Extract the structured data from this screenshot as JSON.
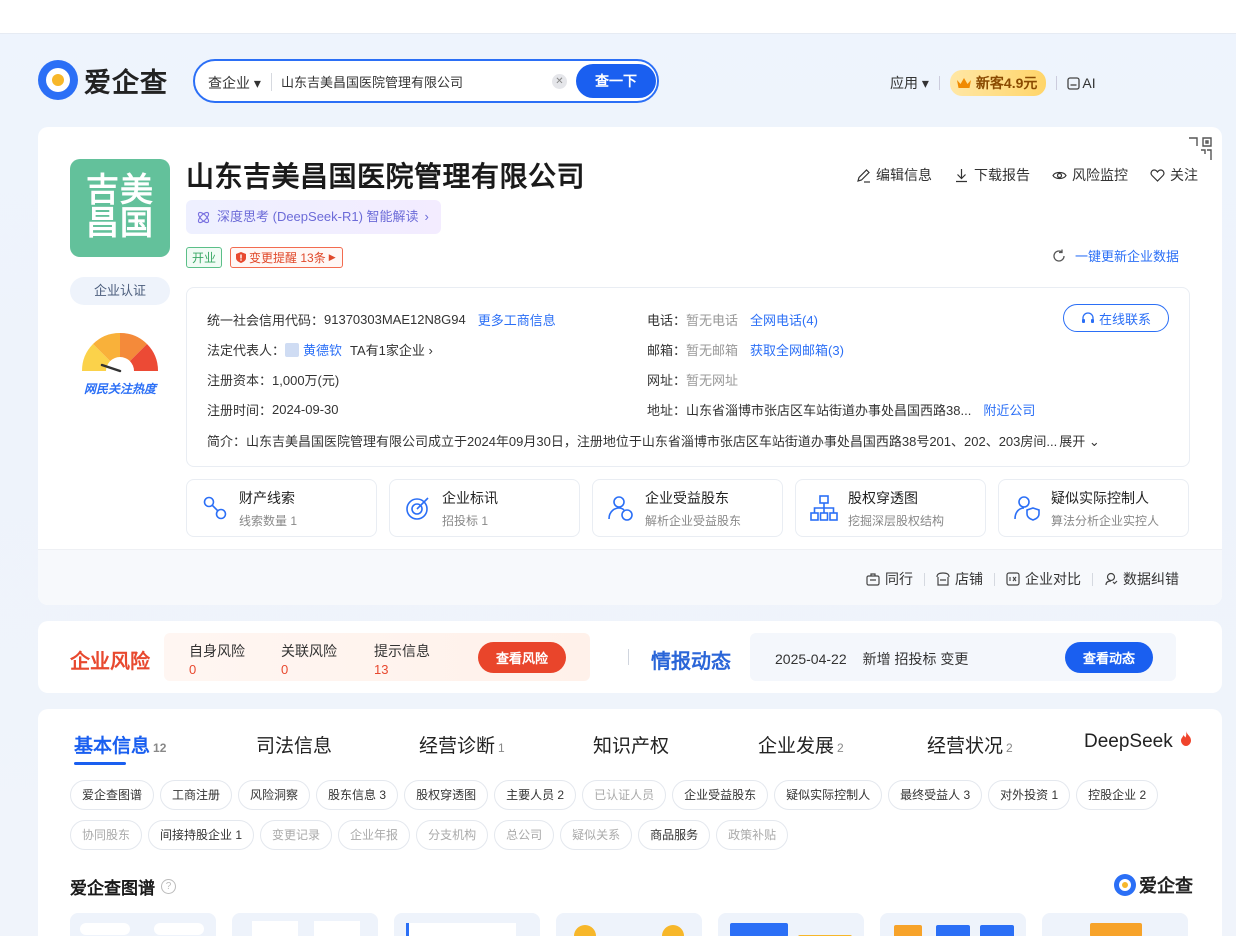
{
  "header": {
    "logo_text": "爱企查",
    "search_type": "查企业",
    "search_value": "山东吉美昌国医院管理有限公司",
    "search_button": "查一下",
    "apps_label": "应用",
    "vip_label": "新客4.9元",
    "ai_label": "AI"
  },
  "company": {
    "avatar_text": "吉美昌国",
    "name": "山东吉美昌国医院管理有限公司",
    "deepseek_tag": "深度思考 (DeepSeek-R1) 智能解读",
    "status": "开业",
    "change_alert": "变更提醒 13条",
    "certify": "企业认证",
    "heat_label": "网民关注热度",
    "actions": [
      "编辑信息",
      "下载报告",
      "风险监控",
      "关注"
    ],
    "refresh": "一键更新企业数据"
  },
  "info": {
    "credit_label": "统一社会信用代码：",
    "credit_value": "91370303MAE12N8G94",
    "more_biz": "更多工商信息",
    "legal_label": "法定代表人：",
    "legal_name": "黄德钦",
    "legal_extra": "TA有1家企业",
    "capital_label": "注册资本：",
    "capital_value": "1,000万(元)",
    "date_label": "注册时间：",
    "date_value": "2024-09-30",
    "phone_label": "电话：",
    "phone_value": "暂无电话",
    "phone_link": "全网电话(4)",
    "email_label": "邮箱：",
    "email_value": "暂无邮箱",
    "email_link": "获取全网邮箱(3)",
    "web_label": "网址：",
    "web_value": "暂无网址",
    "addr_label": "地址：",
    "addr_value": "山东省淄博市张店区车站街道办事处昌国西路38...",
    "addr_link": "附近公司",
    "online_contact": "在线联系",
    "intro_label": "简介：",
    "intro_value": "山东吉美昌国医院管理有限公司成立于2024年09月30日，注册地位于山东省淄博市张店区车站街道办事处昌国西路38号201、202、203房间...",
    "expand": "展开"
  },
  "features": [
    {
      "title": "财产线索",
      "sub": "线索数量 1",
      "icon": "property-clue-icon"
    },
    {
      "title": "企业标讯",
      "sub": "招投标 1",
      "icon": "bid-target-icon"
    },
    {
      "title": "企业受益股东",
      "sub": "解析企业受益股东",
      "icon": "beneficiary-icon"
    },
    {
      "title": "股权穿透图",
      "sub": "挖掘深层股权结构",
      "icon": "equity-tree-icon"
    },
    {
      "title": "疑似实际控制人",
      "sub": "算法分析企业实控人",
      "icon": "controller-icon"
    }
  ],
  "tools": [
    "同行",
    "店铺",
    "企业对比",
    "数据纠错"
  ],
  "risk": {
    "title": "企业风险",
    "items": [
      {
        "label": "自身风险",
        "value": "0"
      },
      {
        "label": "关联风险",
        "value": "0"
      },
      {
        "label": "提示信息",
        "value": "13"
      }
    ],
    "button": "查看风险"
  },
  "intel": {
    "title": "情报动态",
    "date": "2025-04-22",
    "text": "新增 招投标 变更",
    "button": "查看动态"
  },
  "tabs": [
    {
      "label": "基本信息",
      "count": "12"
    },
    {
      "label": "司法信息",
      "count": ""
    },
    {
      "label": "经营诊断",
      "count": "1"
    },
    {
      "label": "知识产权",
      "count": ""
    },
    {
      "label": "企业发展",
      "count": "2"
    },
    {
      "label": "经营状况",
      "count": "2"
    },
    {
      "label": "DeepSeek",
      "count": ""
    }
  ],
  "chips": [
    {
      "label": "爱企查图谱",
      "disabled": false
    },
    {
      "label": "工商注册",
      "disabled": false
    },
    {
      "label": "风险洞察",
      "disabled": false
    },
    {
      "label": "股东信息 3",
      "disabled": false
    },
    {
      "label": "股权穿透图",
      "disabled": false
    },
    {
      "label": "主要人员 2",
      "disabled": false
    },
    {
      "label": "已认证人员",
      "disabled": true
    },
    {
      "label": "企业受益股东",
      "disabled": false
    },
    {
      "label": "疑似实际控制人",
      "disabled": false
    },
    {
      "label": "最终受益人 3",
      "disabled": false
    },
    {
      "label": "对外投资 1",
      "disabled": false
    },
    {
      "label": "控股企业 2",
      "disabled": false
    },
    {
      "label": "协同股东",
      "disabled": true
    },
    {
      "label": "间接持股企业 1",
      "disabled": false
    },
    {
      "label": "变更记录",
      "disabled": true
    },
    {
      "label": "企业年报",
      "disabled": true
    },
    {
      "label": "分支机构",
      "disabled": true
    },
    {
      "label": "总公司",
      "disabled": true
    },
    {
      "label": "疑似关系",
      "disabled": true
    },
    {
      "label": "商品服务",
      "disabled": false
    },
    {
      "label": "政策补贴",
      "disabled": true
    }
  ],
  "graph": {
    "title": "爱企查图谱",
    "logo_text": "爱企查"
  }
}
